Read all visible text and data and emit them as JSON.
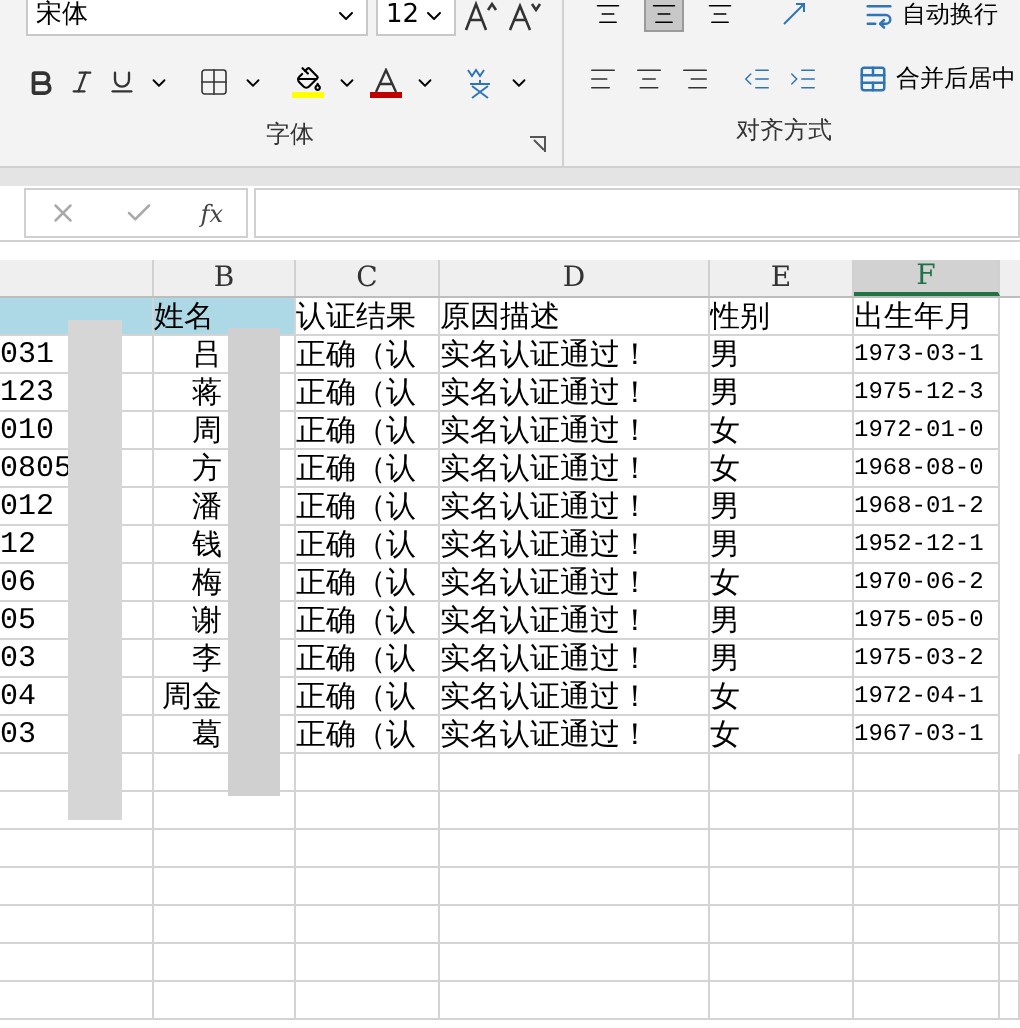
{
  "ribbon": {
    "font_group": {
      "font_name": "宋体",
      "font_size": "12",
      "label": "字体"
    },
    "alignment_group": {
      "vertical_align": [
        {
          "selected": false
        },
        {
          "selected": true
        },
        {
          "selected": false
        }
      ],
      "wrap_text": "自动换行",
      "merge_center": "合并后居中",
      "label": "对齐方式"
    }
  },
  "formula_bar": {
    "fx": "fx"
  },
  "sheet": {
    "columns": [
      {
        "selected": false
      },
      {
        "letter": "B",
        "selected": false
      },
      {
        "letter": "C",
        "selected": false
      },
      {
        "letter": "D",
        "selected": false
      },
      {
        "letter": "E",
        "selected": false
      },
      {
        "letter": "F",
        "selected": true
      }
    ],
    "header_cells": [
      {
        "highlighted": true
      },
      {
        "text": "姓名",
        "highlighted": true
      },
      {
        "text": "认证结果",
        "highlighted": false
      },
      {
        "text": "原因描述",
        "highlighted": false
      },
      {
        "text": "性别",
        "highlighted": false
      },
      {
        "text": "出生年月",
        "highlighted": false
      }
    ],
    "rows": [
      {
        "id": "031",
        "name": "吕",
        "result": "正确（认",
        "reason": "实名认证通过！",
        "gender": "男",
        "birth": "1973-03-1"
      },
      {
        "id": "123",
        "name": "蒋",
        "result": "正确（认",
        "reason": "实名认证通过！",
        "gender": "男",
        "birth": "1975-12-3"
      },
      {
        "id": "010",
        "name": "周",
        "result": "正确（认",
        "reason": "实名认证通过！",
        "gender": "女",
        "birth": "1972-01-0"
      },
      {
        "id": "0805",
        "name": "方",
        "result": "正确（认",
        "reason": "实名认证通过！",
        "gender": "女",
        "birth": "1968-08-0"
      },
      {
        "id": "012",
        "name": "潘",
        "result": "正确（认",
        "reason": "实名认证通过！",
        "gender": "男",
        "birth": "1968-01-2"
      },
      {
        "id": "12",
        "name": "钱",
        "result": "正确（认",
        "reason": "实名认证通过！",
        "gender": "男",
        "birth": "1952-12-1"
      },
      {
        "id": "06",
        "name": "梅",
        "result": "正确（认",
        "reason": "实名认证通过！",
        "gender": "女",
        "birth": "1970-06-2"
      },
      {
        "id": "05",
        "name": "谢",
        "result": "正确（认",
        "reason": "实名认证通过！",
        "gender": "男",
        "birth": "1975-05-0"
      },
      {
        "id": "03",
        "name": "李",
        "result": "正确（认",
        "reason": "实名认证通过！",
        "gender": "男",
        "birth": "1975-03-2"
      },
      {
        "id": "04",
        "name": "周金",
        "result": "正确（认",
        "reason": "实名认证通过！",
        "gender": "女",
        "birth": "1972-04-1"
      },
      {
        "id": "03",
        "name": "葛",
        "result": "正确（认",
        "reason": "实名认证通过！",
        "gender": "女",
        "birth": "1967-03-1"
      }
    ]
  }
}
